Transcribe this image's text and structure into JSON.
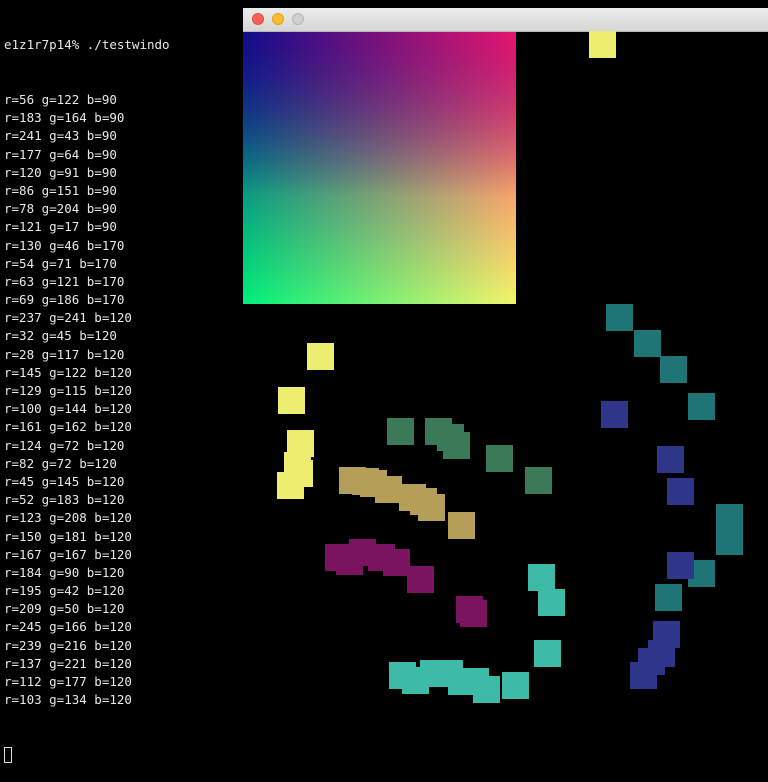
{
  "terminal": {
    "prompt_line": "e1z1r7p14% ./testwindo",
    "lines": [
      "r=56 g=122 b=90",
      "r=183 g=164 b=90",
      "r=241 g=43 b=90",
      "r=177 g=64 b=90",
      "r=120 g=91 b=90",
      "r=86 g=151 b=90",
      "r=78 g=204 b=90",
      "r=121 g=17 b=90",
      "r=130 g=46 b=170",
      "r=54 g=71 b=170",
      "r=63 g=121 b=170",
      "r=69 g=186 b=170",
      "r=237 g=241 b=120",
      "r=32 g=45 b=120",
      "r=28 g=117 b=120",
      "r=145 g=122 b=120",
      "r=129 g=115 b=120",
      "r=100 g=144 b=120",
      "r=161 g=162 b=120",
      "r=124 g=72 b=120",
      "r=82 g=72 b=120",
      "r=45 g=145 b=120",
      "r=52 g=183 b=120",
      "r=123 g=208 b=120",
      "r=150 g=181 b=120",
      "r=167 g=167 b=120",
      "r=184 g=90 b=120",
      "r=195 g=42 b=120",
      "r=209 g=50 b=120",
      "r=245 g=166 b=120",
      "r=239 g=216 b=120",
      "r=137 g=221 b=120",
      "r=112 g=177 b=120",
      "r=103 g=134 b=120"
    ]
  },
  "window": {
    "buttons": [
      {
        "name": "close-button",
        "color": "#fc5f57",
        "border": "#de4a42"
      },
      {
        "name": "minimize-button",
        "color": "#fdbc2e",
        "border": "#dea123"
      },
      {
        "name": "zoom-button",
        "color": "#d0d0d0",
        "border": "#b5b5b5"
      }
    ]
  },
  "squares": [
    {
      "color": "#eded70",
      "count": 7
    },
    {
      "color": "#1f7575",
      "count": 8
    },
    {
      "color": "#2d3688",
      "count": 8
    },
    {
      "color": "#3a7a58",
      "count": 6
    },
    {
      "color": "#b49e58",
      "count": 8
    },
    {
      "color": "#7a1460",
      "count": 8
    },
    {
      "color": "#3dbaa8",
      "count": 11
    }
  ]
}
